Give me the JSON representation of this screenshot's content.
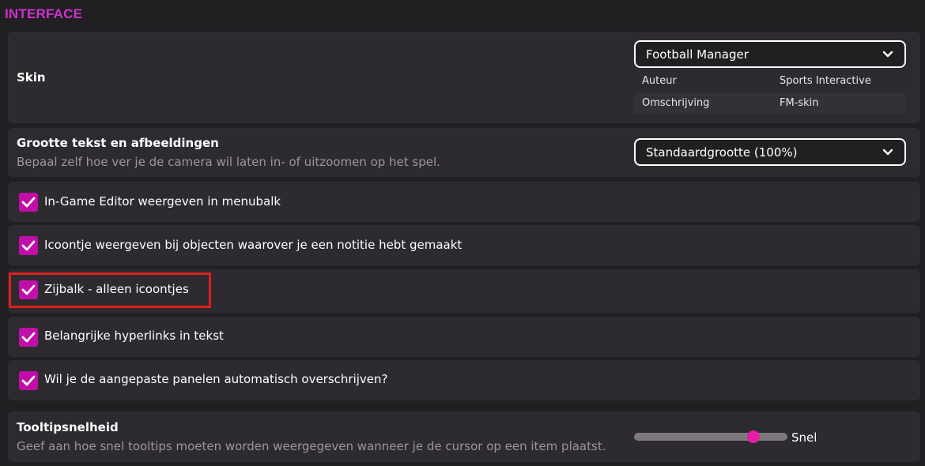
{
  "section": {
    "title": "INTERFACE"
  },
  "skin": {
    "label": "Skin",
    "dropdown_value": "Football Manager",
    "meta": [
      {
        "label": "Auteur",
        "value": "Sports Interactive"
      },
      {
        "label": "Omschrijving",
        "value": "FM-skin"
      }
    ]
  },
  "text_size": {
    "label": "Grootte tekst en afbeeldingen",
    "description": "Bepaal zelf hoe ver je de camera wil laten in- of uitzoomen op het spel.",
    "dropdown_value": "Standaardgrootte (100%)"
  },
  "checkboxes": [
    {
      "label": "In-Game Editor weergeven in menubalk",
      "checked": true
    },
    {
      "label": "Icoontje weergeven bij objecten waarover je een notitie hebt gemaakt",
      "checked": true
    },
    {
      "label": "Zijbalk - alleen icoontjes",
      "checked": true
    },
    {
      "label": "Belangrijke hyperlinks in tekst",
      "checked": true
    },
    {
      "label": "Wil je de aangepaste panelen automatisch overschrijven?",
      "checked": true
    }
  ],
  "tooltip_speed": {
    "label": "Tooltipsnelheid",
    "description": "Geef aan hoe snel tooltips moeten worden weergegeven wanneer je de cursor op een item plaatst.",
    "slider_value_label": "Snel",
    "slider_fraction": 0.78
  },
  "colors": {
    "accent": "#c20ea9",
    "section_title": "#cc33cc",
    "highlight": "#e01e1e",
    "background": "#221f23",
    "row": "#2e2b30"
  }
}
